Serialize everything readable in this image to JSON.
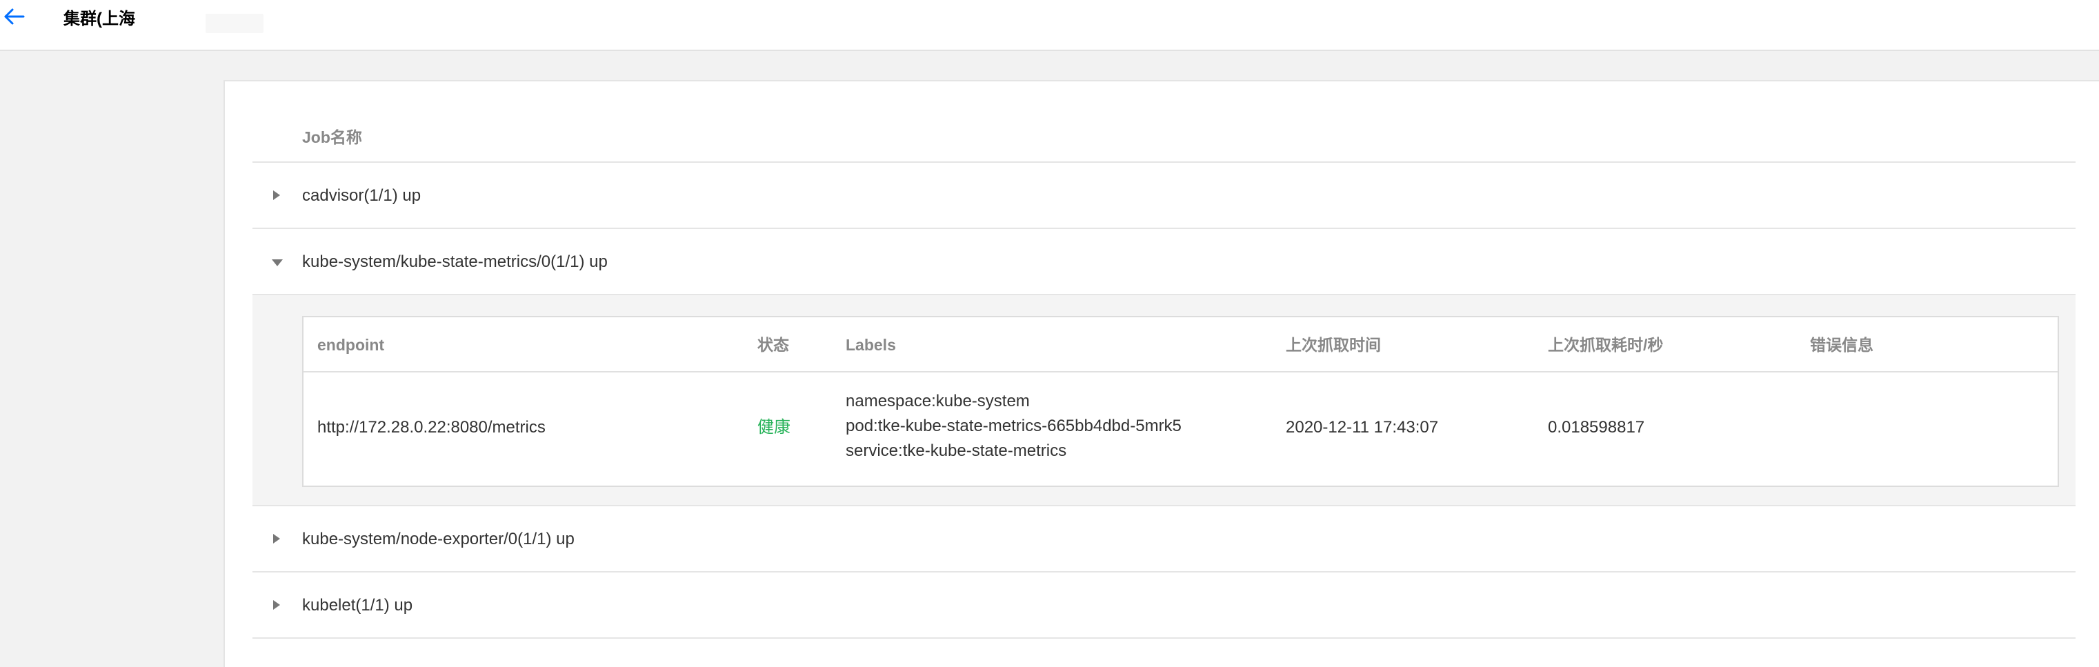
{
  "header": {
    "title": "集群(上海"
  },
  "table": {
    "column_job_name": "Job名称",
    "jobs": [
      {
        "label": "cadvisor(1/1) up",
        "expanded": false
      },
      {
        "label": "kube-system/kube-state-metrics/0(1/1) up",
        "expanded": true
      },
      {
        "label": "kube-system/node-exporter/0(1/1) up",
        "expanded": false
      },
      {
        "label": "kubelet(1/1) up",
        "expanded": false
      }
    ],
    "detail": {
      "columns": {
        "endpoint": "endpoint",
        "status": "状态",
        "labels": "Labels",
        "last_scrape_time": "上次抓取时间",
        "last_scrape_duration": "上次抓取耗时/秒",
        "error": "错误信息"
      },
      "row": {
        "endpoint": "http://172.28.0.22:8080/metrics",
        "status": "健康",
        "labels": [
          "namespace:kube-system",
          "pod:tke-kube-state-metrics-665bb4dbd-5mrk5",
          "service:tke-kube-state-metrics"
        ],
        "last_scrape_time": "2020-12-11 17:43:07",
        "last_scrape_duration": "0.018598817",
        "error": ""
      }
    }
  },
  "colors": {
    "accent": "#006eff",
    "health": "#29b35b"
  }
}
